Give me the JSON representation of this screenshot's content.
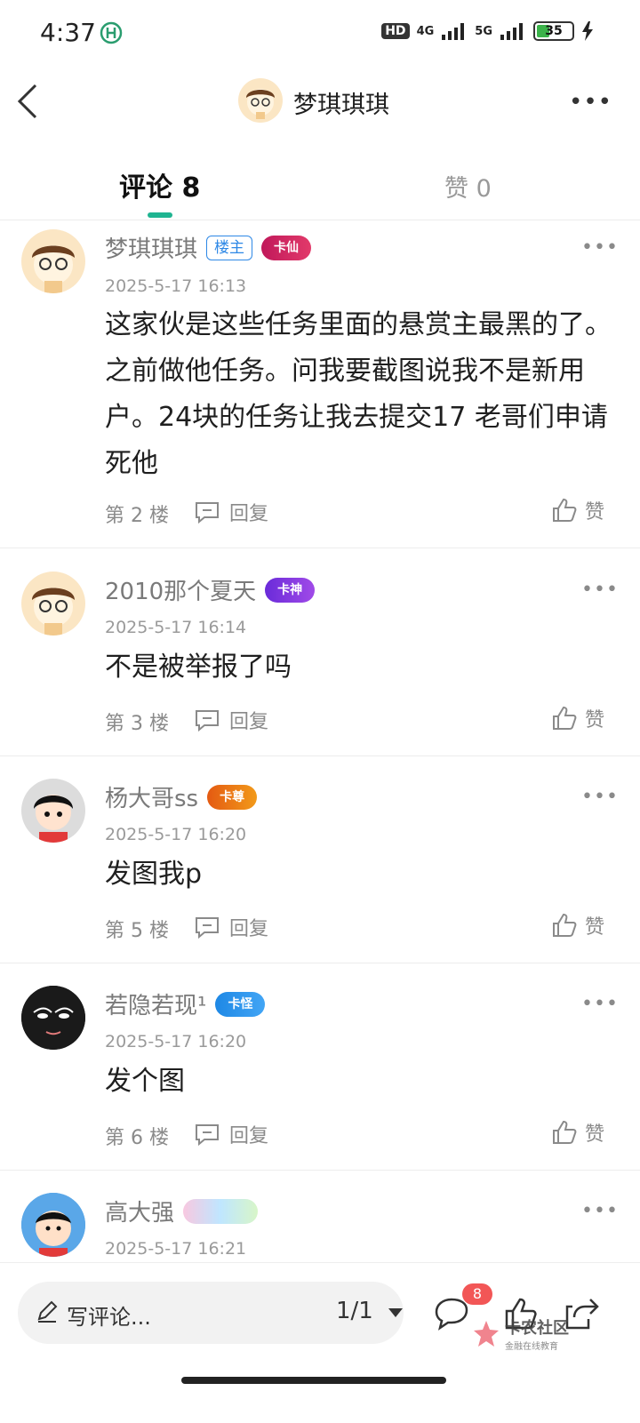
{
  "status_bar": {
    "time": "4:37",
    "network": "HD",
    "net1": "4G",
    "net2": "5G",
    "battery": "35"
  },
  "header": {
    "title": "梦琪琪琪"
  },
  "tabs": {
    "comments_label": "评论",
    "comments_count": "8",
    "likes_label": "赞",
    "likes_count": "0"
  },
  "comments": [
    {
      "name": "梦琪琪琪",
      "host_tag": "楼主",
      "badge": "卡仙",
      "time": "2025-5-17 16:13",
      "text": "这家伙是这些任务里面的悬赏主最黑的了。之前做他任务。问我要截图说我不是新用户。24块的任务让我去提交17 老哥们申请死他",
      "floor": "第 2 楼",
      "reply": "回复",
      "like": "赞"
    },
    {
      "name": "2010那个夏天",
      "badge": "卡神",
      "time": "2025-5-17 16:14",
      "text": "不是被举报了吗",
      "floor": "第 3 楼",
      "reply": "回复",
      "like": "赞"
    },
    {
      "name": "杨大哥ss",
      "badge": "卡尊",
      "time": "2025-5-17 16:20",
      "text": "发图我p",
      "floor": "第 5 楼",
      "reply": "回复",
      "like": "赞"
    },
    {
      "name": "若隐若现¹",
      "badge": "卡怪",
      "time": "2025-5-17 16:20",
      "text": "发个图",
      "floor": "第 6 楼",
      "reply": "回复",
      "like": "赞"
    },
    {
      "name": "高大强",
      "time": "2025-5-17 16:21"
    }
  ],
  "bottom": {
    "write_placeholder": "写评论...",
    "page": "1/1",
    "comment_count": "8",
    "watermark_title": "卡农社区",
    "watermark_sub": "金融在线教育"
  },
  "colors": {
    "accent": "#1fb491",
    "badge_red": "#f25656",
    "host_blue": "#2e88e6"
  }
}
